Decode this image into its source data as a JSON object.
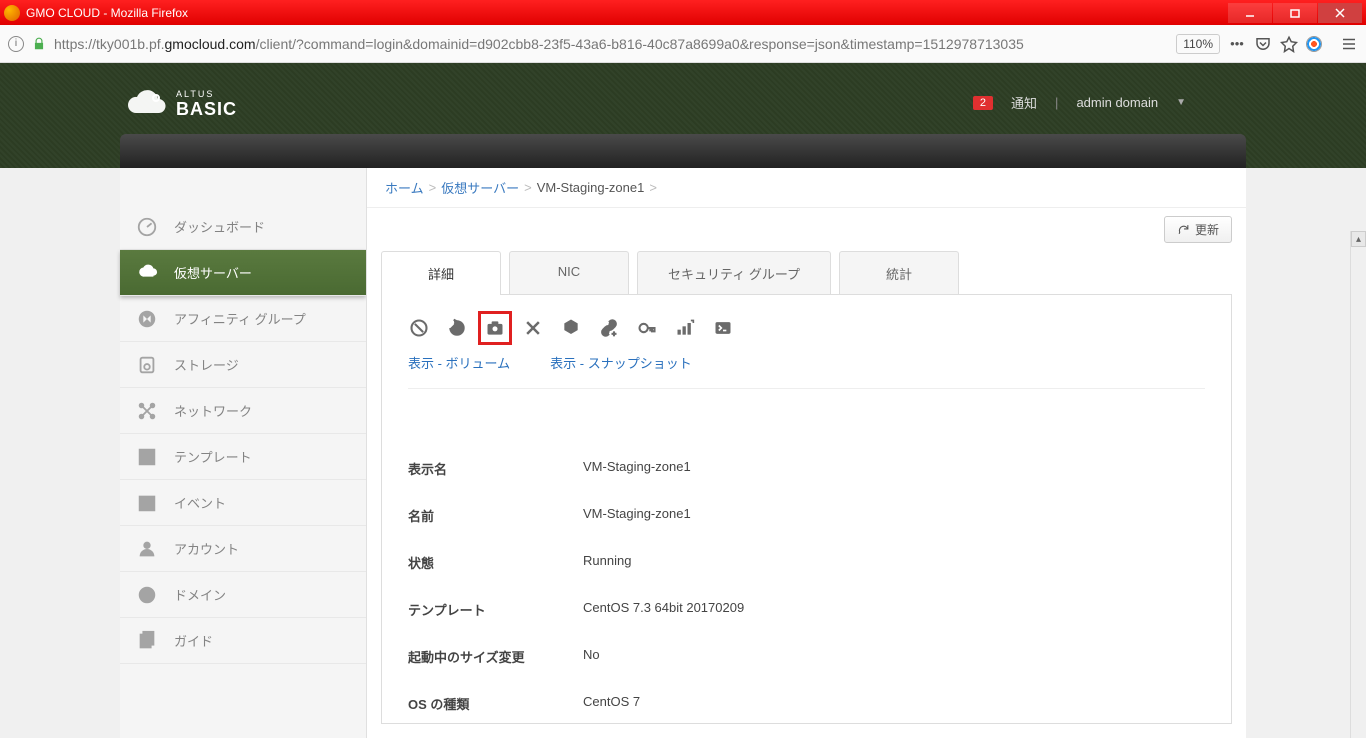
{
  "window": {
    "title": "GMO CLOUD - Mozilla Firefox"
  },
  "browser": {
    "url_prefix": "https://tky001b.pf.",
    "url_domain": "gmocloud.com",
    "url_suffix": "/client/?command=login&domainid=d902cbb8-23f5-43a6-b816-40c87a8699a0&response=json&timestamp=1512978713035",
    "zoom": "110%"
  },
  "header": {
    "logo_small": "ALTUS",
    "logo_big": "BASIC",
    "notification_count": "2",
    "notification_label": "通知",
    "account_label": "admin domain"
  },
  "sidebar": {
    "items": [
      {
        "label": "ダッシュボード"
      },
      {
        "label": "仮想サーバー"
      },
      {
        "label": "アフィニティ グループ"
      },
      {
        "label": "ストレージ"
      },
      {
        "label": "ネットワーク"
      },
      {
        "label": "テンプレート"
      },
      {
        "label": "イベント"
      },
      {
        "label": "アカウント"
      },
      {
        "label": "ドメイン"
      },
      {
        "label": "ガイド"
      }
    ]
  },
  "breadcrumb": {
    "home": "ホーム",
    "level1": "仮想サーバー",
    "current": "VM-Staging-zone1"
  },
  "refresh_label": "更新",
  "tabs": [
    {
      "label": "詳細"
    },
    {
      "label": "NIC"
    },
    {
      "label": "セキュリティ グループ"
    },
    {
      "label": "統計"
    }
  ],
  "sublinks": {
    "volume": "表示 - ボリューム",
    "snapshot": "表示 - スナップショット"
  },
  "details": [
    {
      "label": "表示名",
      "value": "VM-Staging-zone1"
    },
    {
      "label": "名前",
      "value": "VM-Staging-zone1"
    },
    {
      "label": "状態",
      "value": "Running"
    },
    {
      "label": "テンプレート",
      "value": "CentOS 7.3 64bit 20170209"
    },
    {
      "label": "起動中のサイズ変更",
      "value": "No"
    },
    {
      "label": "OS の種類",
      "value": "CentOS 7"
    }
  ]
}
